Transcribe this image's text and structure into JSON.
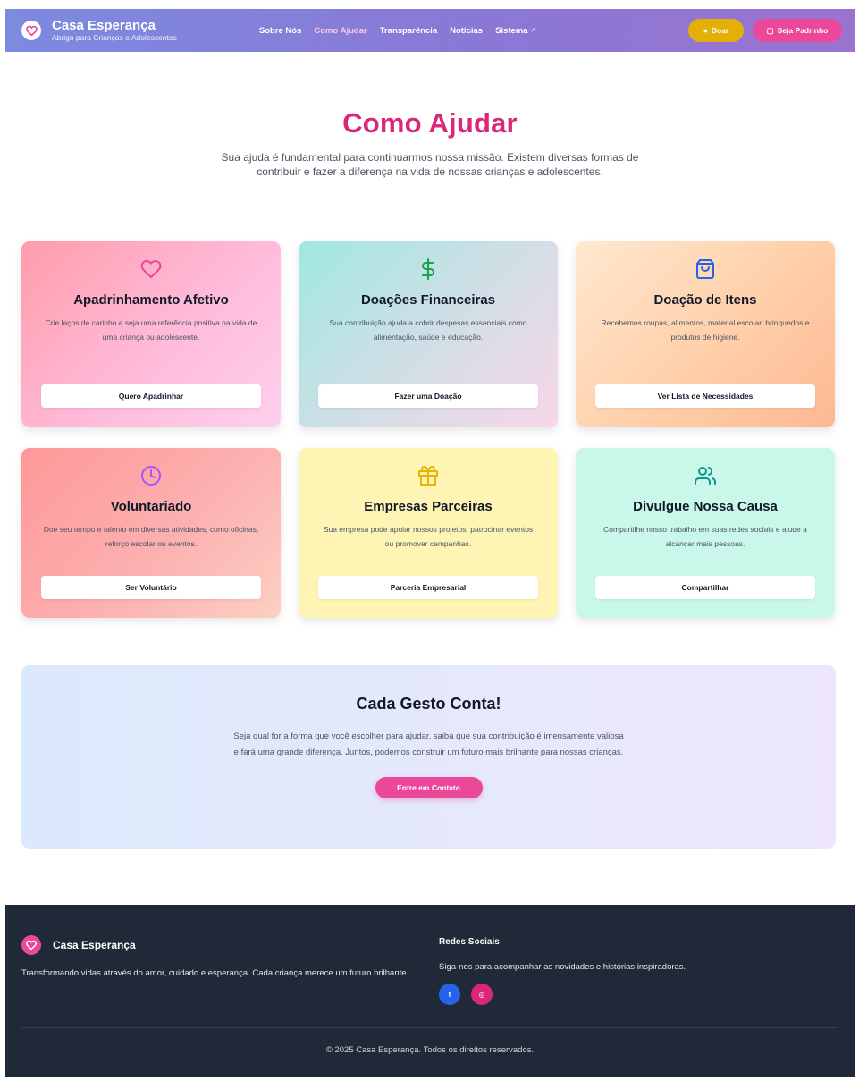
{
  "header": {
    "brand_name": "Casa Esperança",
    "brand_sub": "Abrigo para Crianças e Adolescentes",
    "nav": [
      {
        "label": "Sobre Nós",
        "active": false
      },
      {
        "label": "Como Ajudar",
        "active": true
      },
      {
        "label": "Transparência",
        "active": false
      },
      {
        "label": "Notícias",
        "active": false
      },
      {
        "label": "Sistema",
        "active": false
      }
    ],
    "doar_label": "Doar",
    "padrinho_label": "Seja Padrinho"
  },
  "hero": {
    "title": "Como Ajudar",
    "subtitle": "Sua ajuda é fundamental para continuarmos nossa missão. Existem diversas formas de contribuir e fazer a diferença na vida de nossas crianças e adolescentes."
  },
  "cards": [
    {
      "icon": "heart-icon",
      "color": "#ec4899",
      "title": "Apadrinhamento Afetivo",
      "text": "Crie laços de carinho e seja uma referência positiva na vida de uma criança ou adolescente.",
      "button": "Quero Apadrinhar"
    },
    {
      "icon": "dollar-icon",
      "color": "#16a34a",
      "title": "Doações Financeiras",
      "text": "Sua contribuição ajuda a cobrir despesas essenciais como alimentação, saúde e educação.",
      "button": "Fazer uma Doação"
    },
    {
      "icon": "shopping-bag-icon",
      "color": "#2563eb",
      "title": "Doação de Itens",
      "text": "Recebemos roupas, alimentos, material escolar, brinquedos e produtos de higiene.",
      "button": "Ver Lista de Necessidades"
    },
    {
      "icon": "clock-icon",
      "color": "#a855f7",
      "title": "Voluntariado",
      "text": "Doe seu tempo e talento em diversas atividades, como oficinas, reforço escolar ou eventos.",
      "button": "Ser Voluntário"
    },
    {
      "icon": "gift-icon",
      "color": "#eab308",
      "title": "Empresas Parceiras",
      "text": "Sua empresa pode apoiar nossos projetos, patrocinar eventos ou promover campanhas.",
      "button": "Parceria Empresarial"
    },
    {
      "icon": "users-icon",
      "color": "#0d9488",
      "title": "Divulgue Nossa Causa",
      "text": "Compartilhe nosso trabalho em suas redes sociais e ajude a alcançar mais pessoas.",
      "button": "Compartilhar"
    }
  ],
  "cta": {
    "title": "Cada Gesto Conta!",
    "text": "Seja qual for a forma que você escolher para ajudar, saiba que sua contribuição é imensamente valiosa e fará uma grande diferença. Juntos, podemos construir um futuro mais brilhante para nossas crianças.",
    "button": "Entre em Contato"
  },
  "footer": {
    "brand_name": "Casa Esperança",
    "description": "Transformando vidas através do amor, cuidado e esperança. Cada criança merece um futuro brilhante.",
    "social_title": "Redes Sociais",
    "social_text": "Siga-nos para acompanhar as novidades e histórias inspiradoras.",
    "facebook_glyph": "f",
    "instagram_glyph": "◎",
    "copyright": "© 2025 Casa Esperança. Todos os direitos reservados."
  },
  "colors": {
    "primary_pink": "#db2777",
    "button_pink": "#ec4899",
    "doar_yellow": "#e2b007",
    "footer_bg": "#1f2937"
  }
}
